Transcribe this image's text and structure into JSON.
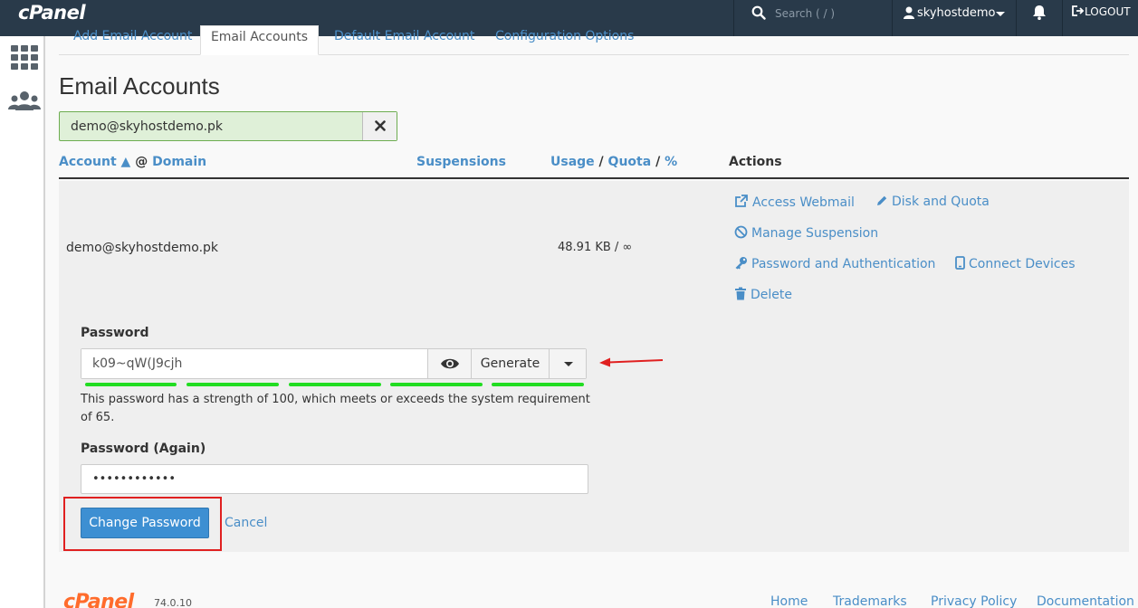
{
  "topbar": {
    "brand": "cPanel",
    "search_placeholder": "Search ( / )",
    "user": "skyhostdemo",
    "logout": "LOGOUT"
  },
  "tabs": [
    "Add Email Account",
    "Email Accounts",
    "Default Email Account",
    "Configuration Options"
  ],
  "active_tab": "Email Accounts",
  "page_title": "Email Accounts",
  "filter": {
    "value": "demo@skyhostdemo.pk"
  },
  "table": {
    "headers": {
      "account": "Account ▲",
      "at": "@",
      "domain": "Domain",
      "suspensions": "Suspensions",
      "usage": "Usage",
      "slash1": "/",
      "quota": "Quota",
      "slash2": "/",
      "percent": "%",
      "actions": "Actions"
    },
    "row": {
      "account": "demo@skyhostdemo.pk",
      "usage": "48.91 KB / ∞"
    },
    "actions": {
      "webmail": "Access Webmail",
      "disk": "Disk and Quota",
      "suspension": "Manage Suspension",
      "password": "Password and Authentication",
      "devices": "Connect Devices",
      "delete": "Delete"
    }
  },
  "password_form": {
    "password_label": "Password",
    "password_value": "k09~qW(J9cjh",
    "generate_label": "Generate",
    "strength_text": "This password has a strength of 100, which meets or exceeds the system requirement of 65.",
    "password_again_label": "Password (Again)",
    "password_again_value": "••••••••••••",
    "submit_label": "Change Password",
    "cancel_label": "Cancel"
  },
  "footer": {
    "brand": "cPanel",
    "version": "74.0.10",
    "links": [
      "Home",
      "Trademarks",
      "Privacy Policy",
      "Documentation"
    ]
  },
  "colors": {
    "topbar": "#293a4a",
    "link": "#4a8ec7",
    "primary": "#3d8fd2",
    "strength": "#22dd22",
    "annotation": "#e02020",
    "brand_orange": "#ff6c2c"
  }
}
